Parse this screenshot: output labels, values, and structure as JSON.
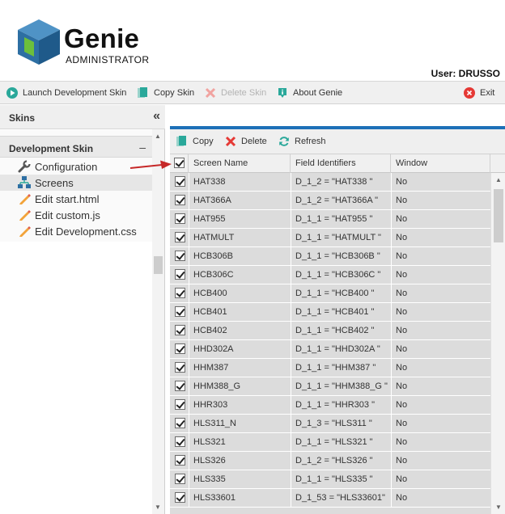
{
  "header": {
    "logo_title": "Genie",
    "logo_subtitle": "ADMINISTRATOR",
    "user_label": "User: DRUSSO"
  },
  "toolbar": {
    "launch": {
      "label": "Launch Development Skin",
      "icon": "play-circle-icon",
      "color": "#2aa89a"
    },
    "copy_skin": {
      "label": "Copy Skin",
      "icon": "copy-icon",
      "color": "#2aa89a"
    },
    "delete_skin": {
      "label": "Delete Skin",
      "icon": "delete-x-icon",
      "disabled": true
    },
    "about": {
      "label": "About Genie",
      "icon": "info-icon",
      "color": "#2aa89a"
    },
    "exit": {
      "label": "Exit",
      "icon": "exit-icon",
      "color": "#e53935"
    }
  },
  "left": {
    "skins_title": "Skins",
    "collapse_glyph": "«",
    "dev_title": "Development Skin",
    "dev_toggle": "–",
    "tree": [
      {
        "label": "Configuration",
        "icon": "wrench-icon"
      },
      {
        "label": "Screens",
        "icon": "sitemap-icon",
        "selected": true
      },
      {
        "label": "Edit start.html",
        "icon": "pencil-icon"
      },
      {
        "label": "Edit custom.js",
        "icon": "pencil-icon"
      },
      {
        "label": "Edit Development.css",
        "icon": "pencil-icon"
      }
    ]
  },
  "grid_toolbar": {
    "copy": "Copy",
    "delete": "Delete",
    "refresh": "Refresh"
  },
  "grid": {
    "columns": [
      "Screen Name",
      "Field Identifiers",
      "Window"
    ],
    "rows": [
      {
        "name": "HAT338",
        "fields": "D_1_2 = \"HAT338 \"",
        "window": "No"
      },
      {
        "name": "HAT366A",
        "fields": "D_1_2 = \"HAT366A \"",
        "window": "No"
      },
      {
        "name": "HAT955",
        "fields": "D_1_1 = \"HAT955 \"",
        "window": "No"
      },
      {
        "name": "HATMULT",
        "fields": "D_1_1 = \"HATMULT \"",
        "window": "No"
      },
      {
        "name": "HCB306B",
        "fields": "D_1_1 = \"HCB306B \"",
        "window": "No"
      },
      {
        "name": "HCB306C",
        "fields": "D_1_1 = \"HCB306C \"",
        "window": "No"
      },
      {
        "name": "HCB400",
        "fields": "D_1_1 = \"HCB400 \"",
        "window": "No"
      },
      {
        "name": "HCB401",
        "fields": "D_1_1 = \"HCB401 \"",
        "window": "No"
      },
      {
        "name": "HCB402",
        "fields": "D_1_1 = \"HCB402 \"",
        "window": "No"
      },
      {
        "name": "HHD302A",
        "fields": "D_1_1 = \"HHD302A \"",
        "window": "No"
      },
      {
        "name": "HHM387",
        "fields": "D_1_1 = \"HHM387 \"",
        "window": "No"
      },
      {
        "name": "HHM388_G",
        "fields": "D_1_1 = \"HHM388_G \"",
        "window": "No"
      },
      {
        "name": "HHR303",
        "fields": "D_1_1 = \"HHR303 \"",
        "window": "No"
      },
      {
        "name": "HLS311_N",
        "fields": "D_1_3 = \"HLS311 \"",
        "window": "No"
      },
      {
        "name": "HLS321",
        "fields": "D_1_1 = \"HLS321 \"",
        "window": "No"
      },
      {
        "name": "HLS326",
        "fields": "D_1_2 = \"HLS326 \"",
        "window": "No"
      },
      {
        "name": "HLS335",
        "fields": "D_1_1 = \"HLS335 \"",
        "window": "No"
      },
      {
        "name": "HLS33601",
        "fields": "D_1_53 = \"HLS33601\"",
        "window": "No"
      }
    ]
  },
  "colors": {
    "accent": "#1d70b8",
    "teal": "#2aa89a",
    "danger": "#e53935",
    "arrow": "#c62828"
  }
}
